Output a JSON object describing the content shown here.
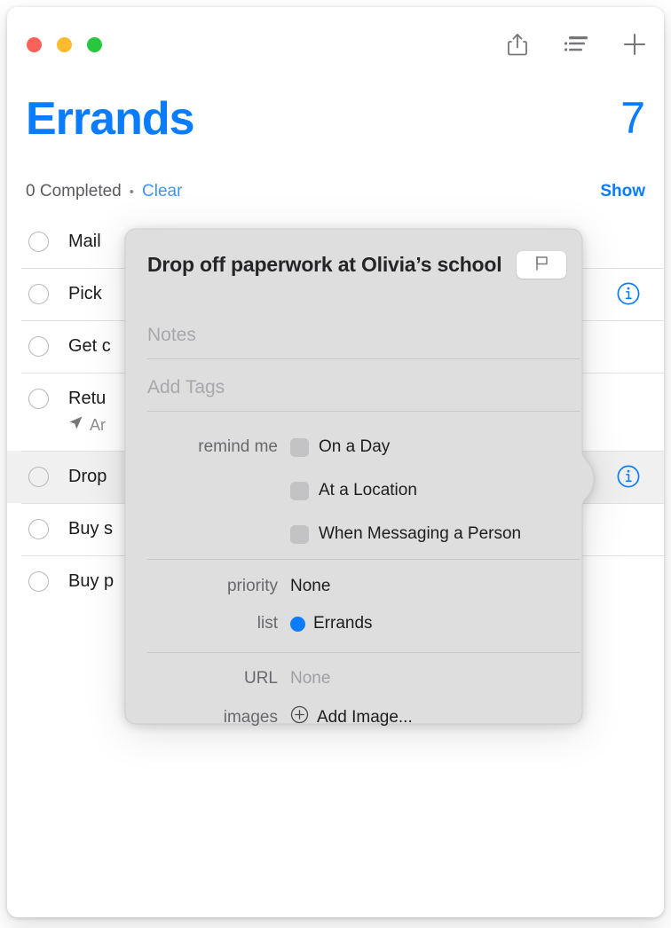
{
  "window": {
    "traffic_lights": [
      {
        "name": "close",
        "color": "#fa6259"
      },
      {
        "name": "minimize",
        "color": "#fcbb2e"
      },
      {
        "name": "maximize",
        "color": "#29c73f"
      }
    ],
    "toolbar": [
      {
        "name": "share-icon",
        "label": "Share"
      },
      {
        "name": "list-view-icon",
        "label": "View Options"
      },
      {
        "name": "add-icon",
        "label": "Add Reminder"
      }
    ]
  },
  "header": {
    "title": "Errands",
    "count": "7",
    "completed_text": "0 Completed",
    "separator_dot": "•",
    "clear_label": "Clear",
    "show_label": "Show",
    "accent_color": "#0a7cff"
  },
  "reminders": [
    {
      "title": "Mail",
      "has_info": false,
      "selected": false,
      "subtitle": null
    },
    {
      "title": "Pick",
      "has_info": true,
      "selected": false,
      "subtitle": null
    },
    {
      "title": "Get c",
      "has_info": false,
      "selected": false,
      "subtitle": null
    },
    {
      "title": "Retu",
      "has_info": false,
      "selected": false,
      "subtitle": "Ar"
    },
    {
      "title": "Drop",
      "has_info": true,
      "selected": true,
      "subtitle": null
    },
    {
      "title": "Buy s",
      "has_info": false,
      "selected": false,
      "subtitle": null
    },
    {
      "title": "Buy p",
      "has_info": false,
      "selected": false,
      "subtitle": null
    }
  ],
  "popover": {
    "title": "Drop off paperwork at Olivia’s school",
    "flag_button": "flag-icon",
    "notes_placeholder": "Notes",
    "tags_placeholder": "Add Tags",
    "remind_me": {
      "label": "remind me",
      "options": [
        {
          "label": "On a Day",
          "checked": false
        },
        {
          "label": "At a Location",
          "checked": false
        },
        {
          "label": "When Messaging a Person",
          "checked": false
        }
      ]
    },
    "priority": {
      "label": "priority",
      "value": "None"
    },
    "list": {
      "label": "list",
      "value": "Errands",
      "color": "#0a7cff"
    },
    "url": {
      "label": "URL",
      "value": "None"
    },
    "images": {
      "label": "images",
      "value": "Add Image...",
      "icon": "plus-circle-icon"
    }
  }
}
